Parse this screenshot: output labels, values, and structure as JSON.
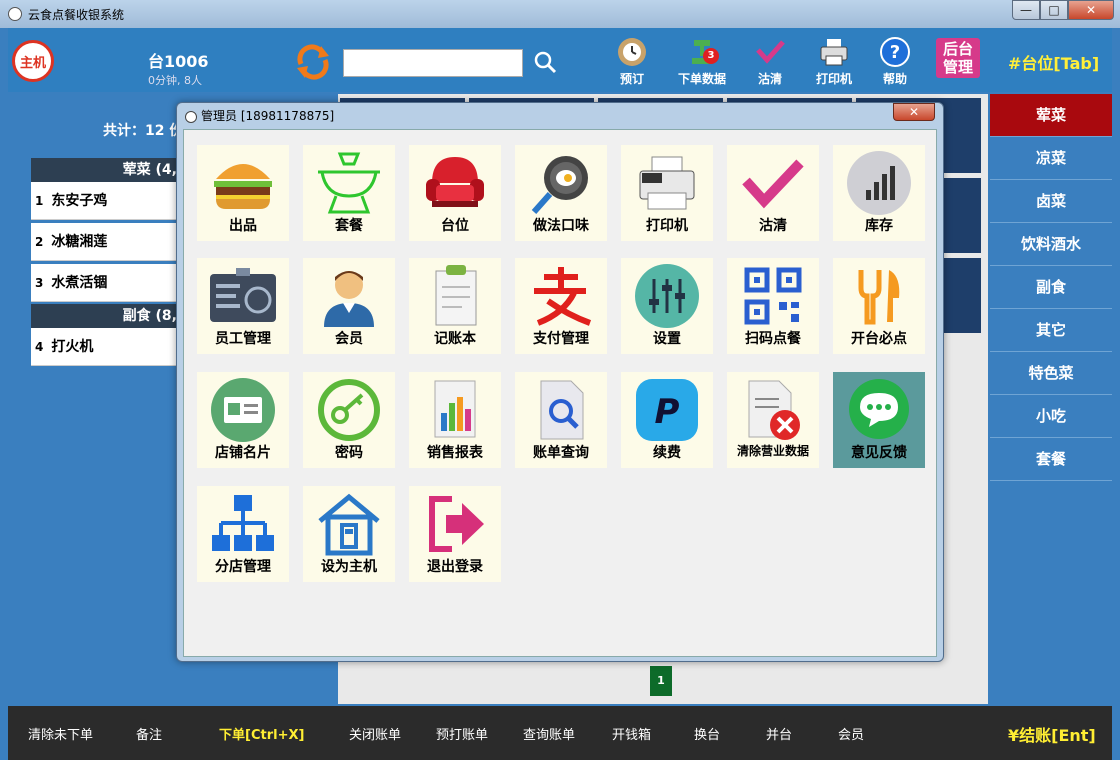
{
  "window": {
    "title": "云食点餐收银系统",
    "min": "—",
    "max": "□",
    "close": "✕"
  },
  "topbar": {
    "host_badge": "主机",
    "table_name": "台1006",
    "table_status": "0分钟, 8人",
    "search_placeholder": "",
    "tools": [
      {
        "label": "预订",
        "icon": "reservation-clock-icon"
      },
      {
        "label": "下单数据",
        "icon": "order-data-icon",
        "badge": "3"
      },
      {
        "label": "沽清",
        "icon": "checkmark-icon"
      },
      {
        "label": "打印机",
        "icon": "printer-icon"
      },
      {
        "label": "帮助",
        "icon": "help-icon"
      }
    ],
    "backend_line1": "后台",
    "backend_line2": "管理",
    "table_tab": "#台位[Tab]"
  },
  "left": {
    "total": "共计：12 份",
    "cat1": "荤菜 (4,",
    "items": [
      {
        "no": "1",
        "name": "东安子鸡"
      },
      {
        "no": "2",
        "name": "冰糖湘莲"
      },
      {
        "no": "3",
        "name": "水煮活锢"
      }
    ],
    "cat2": "副食 (8,",
    "items2": [
      {
        "no": "4",
        "name": "打火机"
      }
    ]
  },
  "center": {
    "page": "1"
  },
  "right_categories": [
    "荤菜",
    "凉菜",
    "卤菜",
    "饮料酒水",
    "副食",
    "其它",
    "特色菜",
    "小吃",
    "套餐"
  ],
  "bottom": {
    "clear_unordered": "清除未下单",
    "note": "备注",
    "place_order": "下单[Ctrl+X]",
    "close_bill": "关闭账单",
    "preprint_bill": "预打账单",
    "query_bill": "查询账单",
    "open_drawer": "开钱箱",
    "change_table": "换台",
    "merge_table": "并台",
    "member": "会员",
    "checkout": "¥结账[Ent]"
  },
  "dialog": {
    "title": "管理员 [18981178875]",
    "close": "✕",
    "cards": [
      {
        "label": "出品",
        "icon": "burger-icon"
      },
      {
        "label": "套餐",
        "icon": "hotpot-icon"
      },
      {
        "label": "台位",
        "icon": "armchair-icon"
      },
      {
        "label": "做法口味",
        "icon": "frying-pan-icon"
      },
      {
        "label": "打印机",
        "icon": "printer-icon"
      },
      {
        "label": "沽清",
        "icon": "checkmark-icon"
      },
      {
        "label": "库存",
        "icon": "bar-chart-icon"
      },
      {
        "label": "员工管理",
        "icon": "id-card-icon"
      },
      {
        "label": "会员",
        "icon": "member-person-icon"
      },
      {
        "label": "记账本",
        "icon": "clipboard-icon"
      },
      {
        "label": "支付管理",
        "icon": "alipay-icon"
      },
      {
        "label": "设置",
        "icon": "sliders-icon"
      },
      {
        "label": "扫码点餐",
        "icon": "qr-code-icon"
      },
      {
        "label": "开台必点",
        "icon": "fork-knife-icon"
      },
      {
        "label": "店铺名片",
        "icon": "business-card-icon"
      },
      {
        "label": "密码",
        "icon": "key-icon"
      },
      {
        "label": "销售报表",
        "icon": "report-icon"
      },
      {
        "label": "账单查询",
        "icon": "bill-search-icon"
      },
      {
        "label": "续费",
        "icon": "paypal-icon"
      },
      {
        "label": "清除营业数据",
        "icon": "clear-data-icon"
      },
      {
        "label": "意见反馈",
        "icon": "chat-bubble-icon"
      },
      {
        "label": "分店管理",
        "icon": "org-chart-icon"
      },
      {
        "label": "设为主机",
        "icon": "house-icon"
      },
      {
        "label": "退出登录",
        "icon": "logout-icon"
      }
    ]
  },
  "colors": {
    "accent": "#a9090e",
    "panel": "#3a7fbf",
    "yellow": "#ffee33"
  }
}
